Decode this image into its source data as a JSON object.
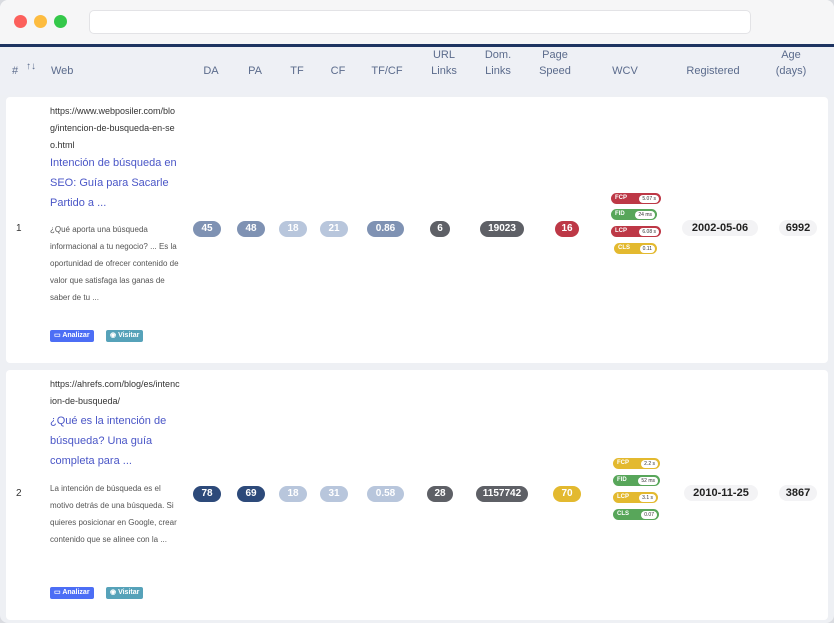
{
  "colors": {
    "blue_dark": "#2d4a7a",
    "blue_mid": "#7f92b3",
    "blue_light": "#b8c6dc",
    "gray_dark": "#5e6066",
    "red": "#bd3846",
    "yellow": "#e3b92f",
    "green": "#58a65a",
    "link": "#4a56c7"
  },
  "headers": {
    "num": "#",
    "web": "Web",
    "da": "DA",
    "pa": "PA",
    "tf": "TF",
    "cf": "CF",
    "tfcf": "TF/CF",
    "url_links_1": "URL",
    "url_links_2": "Links",
    "dom_links_1": "Dom.",
    "dom_links_2": "Links",
    "page_speed_1": "Page",
    "page_speed_2": "Speed",
    "wcv": "WCV",
    "registered": "Registered",
    "age_1": "Age",
    "age_2": "(days)",
    "sort_icon": "sort-arrows-icon"
  },
  "rows": [
    {
      "num": "1",
      "url": "https://www.webposiler.com/blog/intencion-de-busqueda-en-seo.html",
      "title": "Intención de búsqueda en SEO: Guía para Sacarle Partido a ...",
      "description": "¿Qué aporta una búsqueda informacional a tu negocio? ... Es la oportunidad de ofrecer contenido de valor que satisfaga las ganas de saber de tu ...",
      "analizar": "Analizar",
      "visitar": "Visitar",
      "da": "45",
      "pa": "48",
      "tf": "18",
      "cf": "21",
      "tfcf": "0.86",
      "url_links": "6",
      "dom_links": "19023",
      "page_speed": "16",
      "cwv": [
        {
          "label": "FCP",
          "value": "5.07 s"
        },
        {
          "label": "FID",
          "value": "24 ms"
        },
        {
          "label": "LCP",
          "value": "6.08 s"
        },
        {
          "label": "CLS",
          "value": "0.11"
        }
      ],
      "registered": "2002-05-06",
      "age": "6992"
    },
    {
      "num": "2",
      "url": "https://ahrefs.com/blog/es/intencion-de-busqueda/",
      "title": "¿Qué es la intención de búsqueda? Una guía completa para ...",
      "description": "La intención de búsqueda es el motivo detrás de una búsqueda. Si quieres posicionar en Google, crear contenido que se alinee con la ...",
      "analizar": "Analizar",
      "visitar": "Visitar",
      "da": "78",
      "pa": "69",
      "tf": "18",
      "cf": "31",
      "tfcf": "0.58",
      "url_links": "28",
      "dom_links": "1157742",
      "page_speed": "70",
      "cwv": [
        {
          "label": "FCP",
          "value": "2.2 s"
        },
        {
          "label": "FID",
          "value": "52 ms"
        },
        {
          "label": "LCP",
          "value": "3.1 s"
        },
        {
          "label": "CLS",
          "value": "0.07"
        }
      ],
      "registered": "2010-11-25",
      "age": "3867"
    }
  ]
}
